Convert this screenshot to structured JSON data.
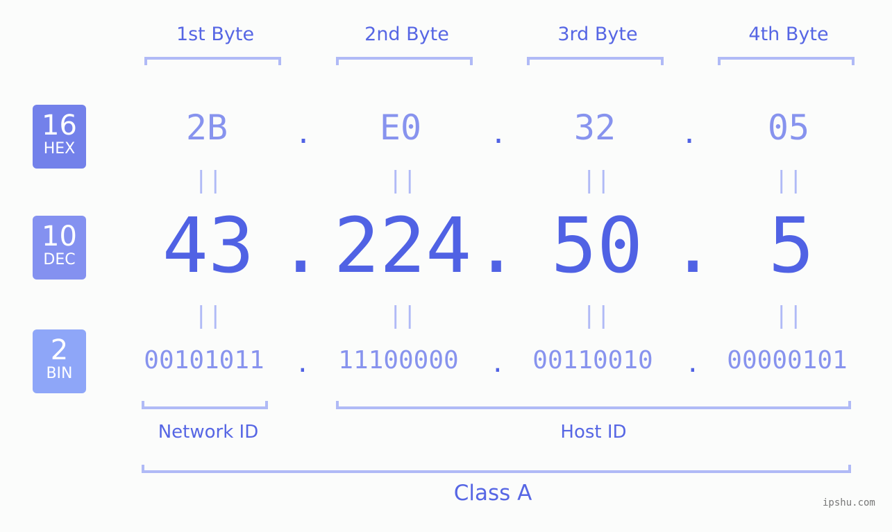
{
  "byte_headers": [
    "1st Byte",
    "2nd Byte",
    "3rd Byte",
    "4th Byte"
  ],
  "badges": [
    {
      "number": "16",
      "label": "HEX",
      "color": "#7381ea"
    },
    {
      "number": "10",
      "label": "DEC",
      "color": "#8491f0"
    },
    {
      "number": "2",
      "label": "BIN",
      "color": "#8ea6f8"
    }
  ],
  "hex": [
    "2B",
    "E0",
    "32",
    "05"
  ],
  "dec": [
    "43",
    "224",
    "50",
    "5"
  ],
  "bin": [
    "00101011",
    "11100000",
    "00110010",
    "00000101"
  ],
  "separator": ".",
  "equals": "||",
  "network_id_label": "Network ID",
  "host_id_label": "Host ID",
  "class_label": "Class A",
  "watermark": "ipshu.com"
}
